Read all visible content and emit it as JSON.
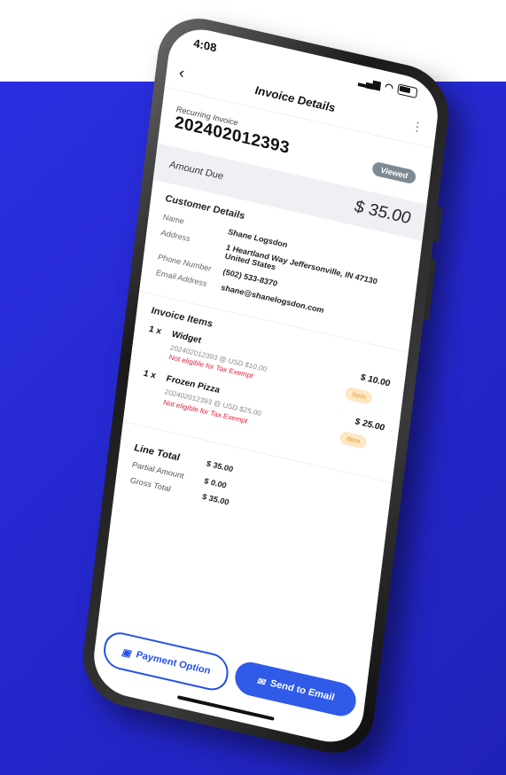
{
  "status_bar": {
    "time": "4:08",
    "signal_icon": "signal-icon",
    "wifi_icon": "wifi-icon",
    "battery_icon": "battery-icon"
  },
  "nav": {
    "back_icon": "chevron-left-icon",
    "title": "Invoice Details",
    "menu_icon": "kebab-menu-icon"
  },
  "invoice": {
    "type_label": "Recurring Invoice",
    "number": "202402012393",
    "status_badge": "Viewed",
    "amount_due_label": "Amount Due",
    "amount_due_value": "$ 35.00"
  },
  "customer": {
    "section_title": "Customer Details",
    "fields": [
      {
        "label": "Name",
        "value": "Shane Logsdon"
      },
      {
        "label": "Address",
        "value": "1 Heartland Way Jeffersonville, IN 47130 United States"
      },
      {
        "label": "Phone Number",
        "value": "(502) 533-8370"
      },
      {
        "label": "Email Address",
        "value": "shane@shanelogsdon.com"
      }
    ]
  },
  "items": {
    "section_title": "Invoice Items",
    "list": [
      {
        "qty": "1 x",
        "name": "Widget",
        "price": "$ 10.00",
        "desc": "202402012393 @ USD $10.00",
        "warning": "Not eligible for Tax Exempt",
        "tag": "Item"
      },
      {
        "qty": "1 x",
        "name": "Frozen Pizza",
        "price": "$ 25.00",
        "desc": "202402012393 @ USD $25.00",
        "warning": "Not eligible for Tax Exempt",
        "tag": "Item"
      }
    ]
  },
  "totals": [
    {
      "label": "Line Total",
      "value": "$ 35.00"
    },
    {
      "label": "Partial Amount",
      "value": "$ 0.00"
    },
    {
      "label": "Gross Total",
      "value": "$ 35.00"
    }
  ],
  "actions": {
    "payment_option": "Payment Option",
    "payment_icon": "wallet-icon",
    "send_email": "Send to Email",
    "email_icon": "envelope-icon"
  },
  "colors": {
    "background": "#2b2fe0",
    "accent": "#2f5be8",
    "warning": "#e0203a",
    "tag_bg": "#fde8c4"
  }
}
